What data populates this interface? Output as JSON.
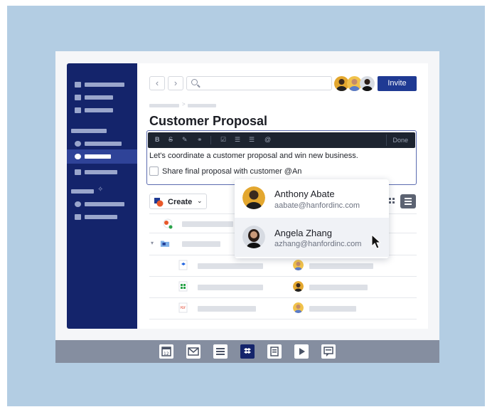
{
  "header": {
    "invite_label": "Invite"
  },
  "document": {
    "title": "Customer Proposal",
    "body_text": "Let's coordinate a customer proposal and win new business.",
    "task_text": "Share final proposal with customer  @An"
  },
  "toolbar": {
    "done_label": "Done"
  },
  "create": {
    "label": "Create"
  },
  "mentions": [
    {
      "name": "Anthony Abate",
      "email": "aabate@hanfordinc.com"
    },
    {
      "name": "Angela Zhang",
      "email": "azhang@hanfordinc.com"
    }
  ],
  "colors": {
    "sidebar": "#14246b",
    "accent": "#1f3a93",
    "background": "#b3cde3",
    "dock": "#858ea0"
  },
  "icons": [
    "search-icon",
    "chevron-left-icon",
    "chevron-right-icon",
    "checkbox-icon",
    "folder-icon",
    "calendar-icon",
    "mail-icon",
    "list-icon",
    "dropbox-icon",
    "document-icon",
    "play-icon",
    "chat-icon"
  ]
}
